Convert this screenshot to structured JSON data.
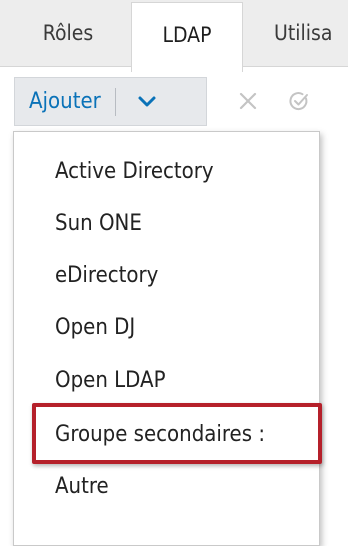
{
  "tabs": [
    {
      "label": "Rôles",
      "active": false
    },
    {
      "label": "LDAP",
      "active": true
    },
    {
      "label": "Utilisa",
      "active": false
    }
  ],
  "toolbar": {
    "add_label": "Ajouter",
    "dropdown_icon": "chevron-down-icon",
    "close_icon": "close-icon",
    "check_icon": "check-circle-icon"
  },
  "menu": {
    "items": [
      "Active Directory",
      "Sun ONE",
      "eDirectory",
      "Open DJ",
      "Open LDAP",
      "Groupe secondaires :",
      "Autre"
    ],
    "highlighted_index": 5
  },
  "colors": {
    "accent": "#0a72b8",
    "highlight_border": "#b5202a",
    "tabbar_bg": "#ededed",
    "button_bg": "#e7e9ec"
  }
}
